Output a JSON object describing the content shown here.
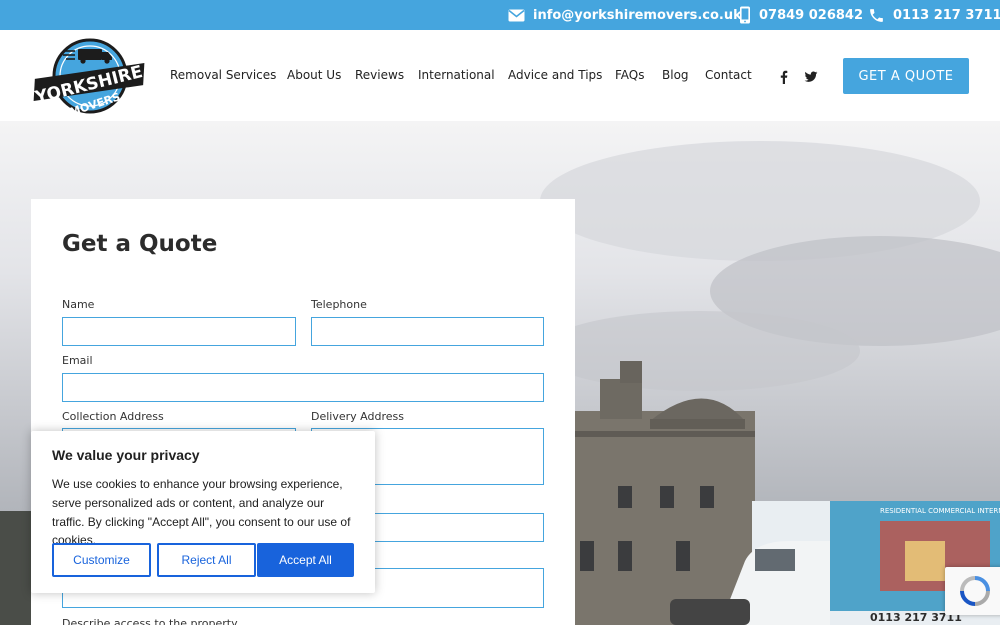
{
  "topbar": {
    "email": "info@yorkshiremovers.co.uk",
    "mobile": "07849 026842",
    "phone": "0113 217 3711"
  },
  "logo": {
    "line1": "YORKSHIRE",
    "line2": "MOVERS"
  },
  "nav": {
    "items": [
      "Removal Services",
      "About Us",
      "Reviews",
      "International",
      "Advice and Tips",
      "FAQs",
      "Blog",
      "Contact"
    ],
    "cta": "GET A QUOTE"
  },
  "form": {
    "title": "Get a Quote",
    "name_label": "Name",
    "telephone_label": "Telephone",
    "email_label": "Email",
    "collection_label": "Collection Address",
    "delivery_label": "Delivery Address",
    "access_label": "Describe access to the property"
  },
  "cookie": {
    "title": "We value your privacy",
    "text": "We use cookies to enhance your browsing experience, serve personalized ads or content, and analyze our traffic. By clicking \"Accept All\", you consent to our use of cookies.",
    "customize": "Customize",
    "reject": "Reject All",
    "accept": "Accept All"
  },
  "truck": {
    "text": "0113 217 3711",
    "side": "RESIDENTIAL COMMERCIAL INTERNATIONAL"
  },
  "colors": {
    "brand_blue": "#45a5de",
    "cookie_blue": "#1863dc"
  }
}
